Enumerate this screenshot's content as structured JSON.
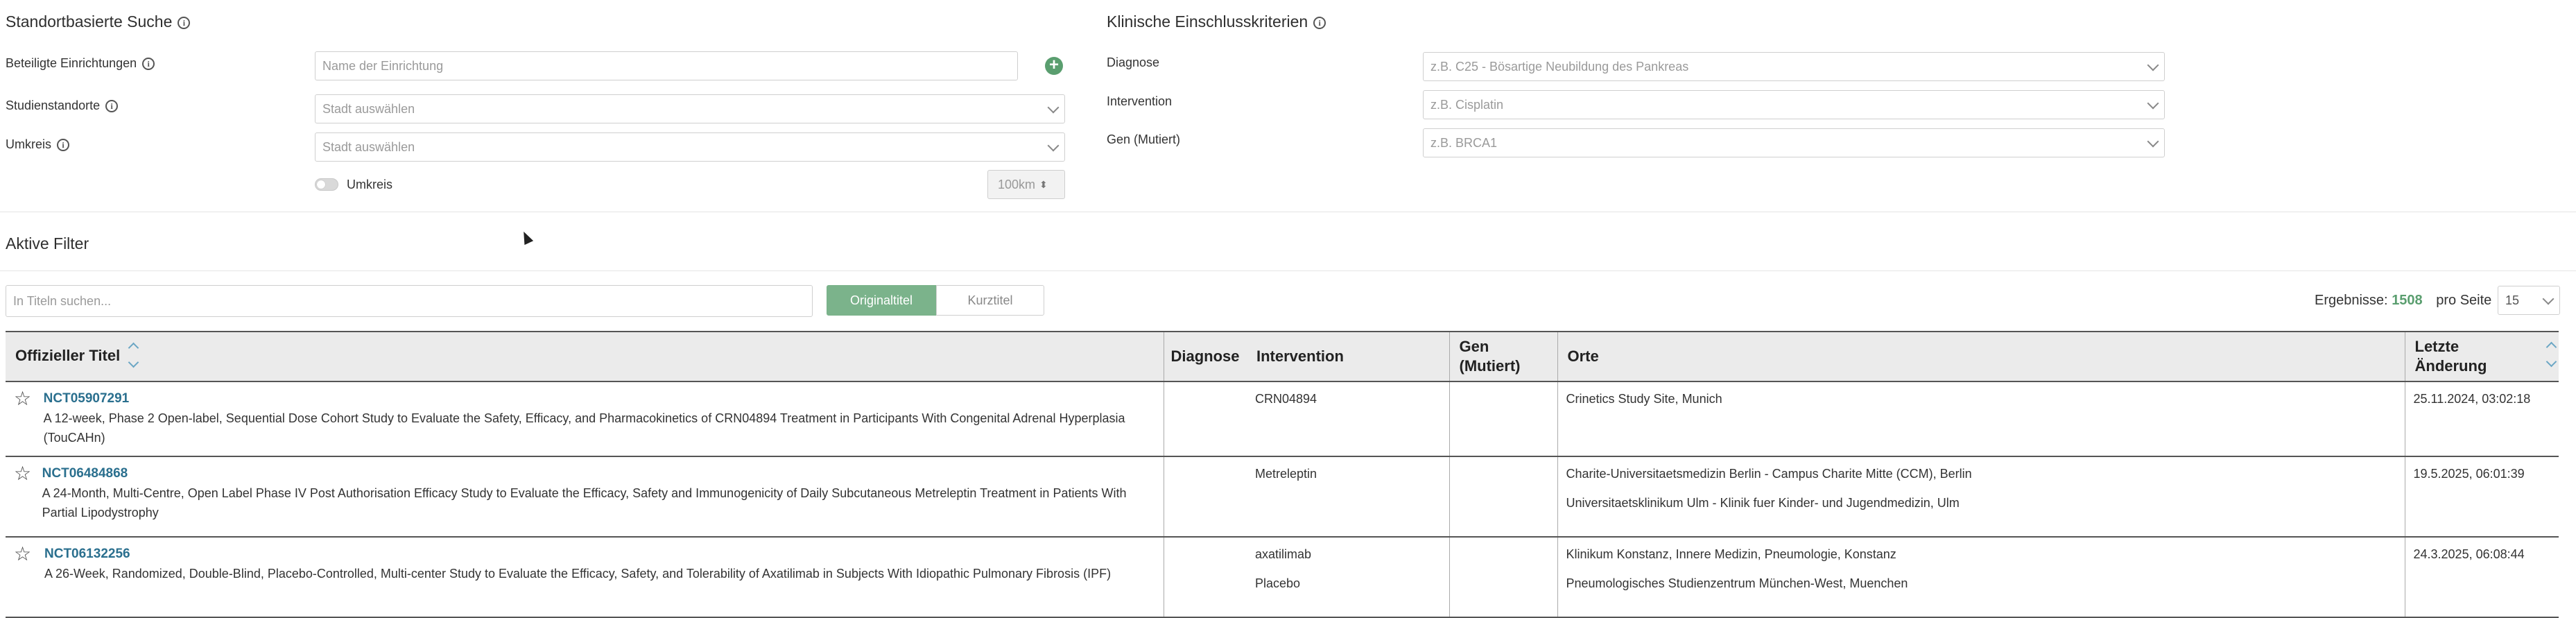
{
  "location_search": {
    "title": "Standortbasierte Suche",
    "participating_label": "Beteiligte Einrichtungen",
    "participating_placeholder": "Name der Einrichtung",
    "sites_label": "Studienstandorte",
    "sites_placeholder": "Stadt auswählen",
    "radius_label": "Umkreis",
    "radius_placeholder": "Stadt auswählen",
    "radius_toggle_label": "Umkreis",
    "radius_km": "100km"
  },
  "clinical_criteria": {
    "title": "Klinische Einschlusskriterien",
    "diagnosis_label": "Diagnose",
    "diagnosis_placeholder": "z.B. C25 - Bösartige Neubildung des Pankreas",
    "intervention_label": "Intervention",
    "intervention_placeholder": "z.B. Cisplatin",
    "gene_label": "Gen (Mutiert)",
    "gene_placeholder": "z.B. BRCA1"
  },
  "active_filters": {
    "title": "Aktive Filter",
    "search_placeholder": "In Titeln suchen...",
    "original_title_label": "Originaltitel",
    "short_title_label": "Kurztitel",
    "results_label": "Ergebnisse:",
    "results_count": "1508",
    "per_page_label": "pro Seite",
    "per_page_value": "15"
  },
  "table": {
    "headers": {
      "title": "Offizieller Titel",
      "diagnosis": "Diagnose",
      "intervention": "Intervention",
      "gene_line1": "Gen",
      "gene_line2": "(Mutiert)",
      "locations": "Orte",
      "last_change_line1": "Letzte",
      "last_change_line2": "Änderung"
    },
    "rows": [
      {
        "id": "NCT05907291",
        "title": "A 12-week, Phase 2 Open-label, Sequential Dose Cohort Study to Evaluate the Safety, Efficacy, and Pharmacokinetics of CRN04894 Treatment in Participants With Congenital Adrenal Hyperplasia (TouCAHn)",
        "diagnosis": "",
        "interventions": [
          "CRN04894"
        ],
        "gene": "",
        "locations": [
          "Crinetics Study Site, Munich"
        ],
        "last_change": "25.11.2024, 03:02:18"
      },
      {
        "id": "NCT06484868",
        "title": "A 24-Month, Multi-Centre, Open Label Phase IV Post Authorisation Efficacy Study to Evaluate the Efficacy, Safety and Immunogenicity of Daily Subcutaneous Metreleptin Treatment in Patients With Partial Lipodystrophy",
        "diagnosis": "",
        "interventions": [
          "Metreleptin"
        ],
        "gene": "",
        "locations": [
          "Charite-Universitaetsmedizin Berlin - Campus Charite Mitte (CCM), Berlin",
          "Universitaetsklinikum Ulm - Klinik fuer Kinder- und Jugendmedizin, Ulm"
        ],
        "last_change": "19.5.2025, 06:01:39"
      },
      {
        "id": "NCT06132256",
        "title": "A 26-Week, Randomized, Double-Blind, Placebo-Controlled, Multi-center Study to Evaluate the Efficacy, Safety, and Tolerability of Axatilimab in Subjects With Idiopathic Pulmonary Fibrosis (IPF)",
        "diagnosis": "",
        "interventions": [
          "axatilimab",
          "Placebo"
        ],
        "gene": "",
        "locations": [
          "Klinikum Konstanz, Innere Medizin, Pneumologie, Konstanz",
          "Pneumologisches Studienzentrum München-West, Muenchen"
        ],
        "last_change": "24.3.2025, 06:08:44"
      }
    ]
  }
}
